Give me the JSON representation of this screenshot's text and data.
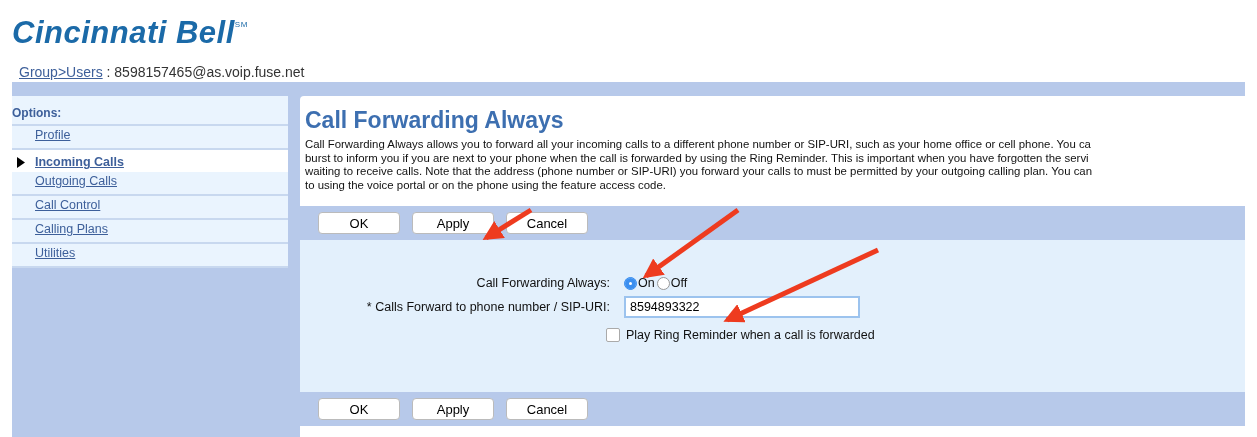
{
  "logo": "Cincinnati Bell$^{SM}$",
  "breadcrumb": {
    "links": [
      "Group",
      ">Users"
    ],
    "user": ": 8598157465@as.voip.fuse.net"
  },
  "sidebar": {
    "heading": "Options:",
    "items": [
      {
        "label": "Profile",
        "selected": false
      },
      {
        "label": "Incoming Calls",
        "selected": true
      },
      {
        "label": "Outgoing Calls",
        "selected": false
      },
      {
        "label": "Call Control",
        "selected": false
      },
      {
        "label": "Calling Plans",
        "selected": false
      },
      {
        "label": "Utilities",
        "selected": false
      }
    ]
  },
  "content": {
    "title": "Call Forwarding Always",
    "description": [
      "Call Forwarding Always allows you to forward all your incoming calls to a different phone number or SIP-URI, such as your home office or cell phone. You ca",
      "burst to inform you if you are next to your phone when the call is forwarded by using the Ring Reminder. This is important when you have forgotten the servi",
      "waiting to receive calls. Note that the address (phone number or SIP-URI) you forward your calls to must be permitted by your outgoing calling plan. You can",
      "to using the voice portal or on the phone using the feature access code."
    ],
    "top_buttons": [
      "OK",
      "Apply",
      "Cancel"
    ],
    "form": {
      "toggle_label": "Call Forwarding Always:",
      "options": [
        {
          "label": "On",
          "selected": true
        },
        {
          "label": "Off",
          "selected": false
        }
      ],
      "number_label": "* Calls Forward to phone number / SIP-URI:",
      "number_value": "8594893322",
      "reminder": {
        "label": "Play Ring Reminder when a call is forwarded",
        "checked": false
      }
    },
    "bottom_buttons": [
      "OK",
      "Apply",
      "Cancel"
    ]
  }
}
